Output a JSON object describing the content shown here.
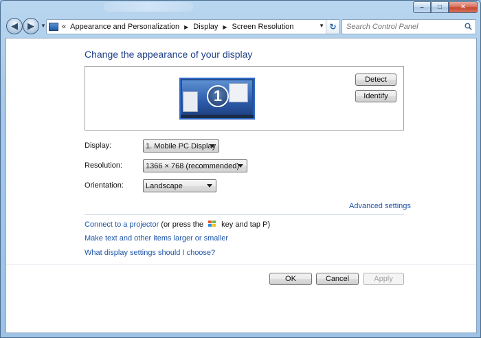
{
  "window": {
    "caption_minimize": "–",
    "caption_maximize": "□",
    "caption_close": "✕"
  },
  "nav": {
    "back_glyph": "◀",
    "forward_glyph": "▶",
    "breadcrumb_chevron": "«",
    "breadcrumbs": [
      "Appearance and Personalization",
      "Display",
      "Screen Resolution"
    ],
    "refresh_glyph": "↻"
  },
  "search": {
    "placeholder": "Search Control Panel"
  },
  "main": {
    "title": "Change the appearance of your display",
    "monitor_number": "1",
    "detect_label": "Detect",
    "identify_label": "Identify",
    "fields": {
      "display_label": "Display:",
      "display_value": "1. Mobile PC Display",
      "resolution_label": "Resolution:",
      "resolution_value": "1366 × 768 (recommended)",
      "orientation_label": "Orientation:",
      "orientation_value": "Landscape"
    },
    "advanced_settings": "Advanced settings",
    "projector_link": "Connect to a projector",
    "projector_text_before": "(or press the",
    "projector_text_after": "key and tap P)",
    "text_size_link": "Make text and other items larger or smaller",
    "help_link": "What display settings should I choose?"
  },
  "footer": {
    "ok_label": "OK",
    "cancel_label": "Cancel",
    "apply_label": "Apply"
  },
  "icons": {
    "back": "back-arrow-icon",
    "forward": "forward-arrow-icon",
    "control_panel": "control-panel-icon",
    "refresh": "refresh-icon",
    "search": "search-icon",
    "windows_key": "windows-logo-icon"
  },
  "colors": {
    "title_blue": "#1e3f8b",
    "link_blue": "#1e55a8",
    "close_red": "#c3432a"
  }
}
